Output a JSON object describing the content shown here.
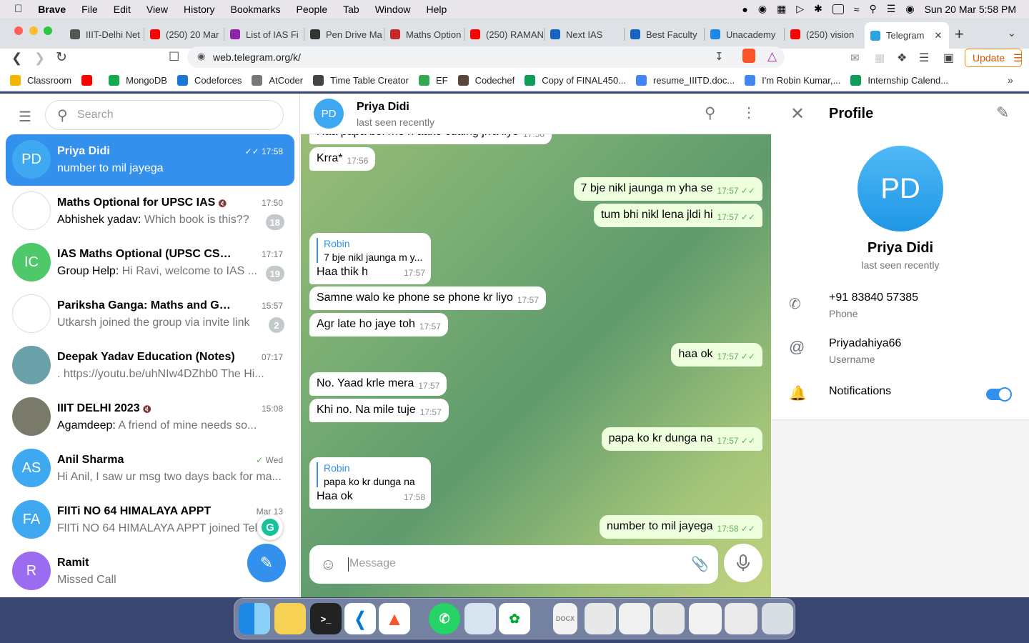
{
  "menubar": {
    "app": "Brave",
    "items": [
      "File",
      "Edit",
      "View",
      "History",
      "Bookmarks",
      "People",
      "Tab",
      "Window",
      "Help"
    ],
    "clock": "Sun 20 Mar  5:58 PM"
  },
  "tabs": [
    {
      "title": "IIIT-Delhi Net",
      "color": "#555"
    },
    {
      "title": "(250) 20 Mar",
      "color": "#ff0000"
    },
    {
      "title": "List of IAS Fi",
      "color": "#8e24aa"
    },
    {
      "title": "Pen Drive Ma",
      "color": "#333"
    },
    {
      "title": "Maths Option",
      "color": "#c62828"
    },
    {
      "title": "(250) RAMAN",
      "color": "#ff0000"
    },
    {
      "title": "Next IAS",
      "color": "#1565c0"
    },
    {
      "title": "Best Faculty",
      "color": "#1565c0"
    },
    {
      "title": "Unacademy",
      "color": "#1e88e5"
    },
    {
      "title": "(250) vision",
      "color": "#ff0000"
    },
    {
      "title": "Telegram",
      "color": "#2aa3e0"
    }
  ],
  "url": "web.telegram.org/k/",
  "update_label": "Update",
  "bookmarks": [
    {
      "label": "Classroom",
      "color": "#f4b400"
    },
    {
      "label": "",
      "color": "#ff0000"
    },
    {
      "label": "MongoDB",
      "color": "#13aa52"
    },
    {
      "label": "Codeforces",
      "color": "#1976d2"
    },
    {
      "label": "AtCoder",
      "color": "#777"
    },
    {
      "label": "Time Table Creator",
      "color": "#444"
    },
    {
      "label": "EF",
      "color": "#34a853"
    },
    {
      "label": "Codechef",
      "color": "#5b4638"
    },
    {
      "label": "Copy of FINAL450...",
      "color": "#0f9d58"
    },
    {
      "label": "resume_IIITD.doc...",
      "color": "#4285f4"
    },
    {
      "label": "I'm Robin Kumar,...",
      "color": "#4285f4"
    },
    {
      "label": "Internship Calend...",
      "color": "#0f9d58"
    }
  ],
  "search": {
    "placeholder": "Search"
  },
  "chats": [
    {
      "initials": "PD",
      "name": "Priya Didi",
      "sender": "",
      "message": "number to mil jayega",
      "time": "17:58",
      "badge": "",
      "color": "#3ea8f0",
      "active": true,
      "read": true,
      "muted": false
    },
    {
      "initials": "",
      "name": "Maths Optional for UPSC IAS",
      "sender": "Abhishek yadav: ",
      "message": "Which book is this??",
      "time": "17:50",
      "badge": "18",
      "color": "#ffffff",
      "active": false,
      "read": false,
      "muted": true
    },
    {
      "initials": "IC",
      "name": "IAS Maths Optional (UPSC CSE)",
      "sender": "Group Help: ",
      "message": "Hi Ravi, welcome to IAS ...",
      "time": "17:17",
      "badge": "19",
      "color": "#4fc86a",
      "active": false,
      "read": false,
      "muted": true
    },
    {
      "initials": "",
      "name": "Pariksha Ganga: Maths and GS(U...",
      "sender": "",
      "message": "Utkarsh joined the group via invite link",
      "time": "15:57",
      "badge": "2",
      "color": "#ffffff",
      "active": false,
      "read": false,
      "muted": true
    },
    {
      "initials": "",
      "name": "Deepak Yadav Education (Notes)",
      "sender": "",
      "message": ". https://youtu.be/uhNIw4DZhb0 The Hi...",
      "time": "07:17",
      "badge": "",
      "color": "#6aa0a8",
      "active": false,
      "read": false,
      "muted": false
    },
    {
      "initials": "",
      "name": "IIIT DELHI 2023",
      "sender": "Agamdeep: ",
      "message": "A friend of mine needs so...",
      "time": "15:08",
      "badge": "",
      "color": "#7a7a6a",
      "active": false,
      "read": false,
      "muted": true
    },
    {
      "initials": "AS",
      "name": "Anil Sharma",
      "sender": "",
      "message": "Hi Anil, I saw ur msg two days back for ma...",
      "time": "Wed",
      "badge": "",
      "color": "#3ea8f0",
      "active": false,
      "read": true,
      "muted": false
    },
    {
      "initials": "FA",
      "name": "FlITi NO 64 HIMALAYA APPT",
      "sender": "",
      "message": "FlITi NO 64 HIMALAYA APPT joined Tel",
      "time": "Mar 13",
      "badge": "",
      "color": "#3ea8f0",
      "active": false,
      "read": false,
      "muted": false
    },
    {
      "initials": "R",
      "name": "Ramit",
      "sender": "",
      "message": "Missed Call",
      "time": "",
      "badge": "",
      "color": "#9b6cf0",
      "active": false,
      "read": false,
      "muted": false
    }
  ],
  "conversation": {
    "initials": "PD",
    "name": "Priya Didi",
    "status": "last seen recently",
    "messages": [
      {
        "dir": "in",
        "text": "Haa papa bol rhe h aake cutting jrra liyo",
        "time": "17:56",
        "reply_name": "",
        "reply_text": ""
      },
      {
        "dir": "in",
        "text": "Krra*",
        "time": "17:56",
        "reply_name": "",
        "reply_text": ""
      },
      {
        "dir": "out",
        "text": "7 bje nikl jaunga m yha se",
        "time": "17:57",
        "reply_name": "",
        "reply_text": ""
      },
      {
        "dir": "out",
        "text": "tum bhi nikl lena jldi hi",
        "time": "17:57",
        "reply_name": "",
        "reply_text": ""
      },
      {
        "dir": "in",
        "text": "Haa thik h",
        "time": "17:57",
        "reply_name": "Robin",
        "reply_text": "7 bje nikl jaunga m y..."
      },
      {
        "dir": "in",
        "text": "Samne walo ke phone se phone kr liyo",
        "time": "17:57",
        "reply_name": "",
        "reply_text": ""
      },
      {
        "dir": "in",
        "text": "Agr late ho jaye toh",
        "time": "17:57",
        "reply_name": "",
        "reply_text": ""
      },
      {
        "dir": "out",
        "text": "haa ok",
        "time": "17:57",
        "reply_name": "",
        "reply_text": ""
      },
      {
        "dir": "in",
        "text": "No. Yaad krle mera",
        "time": "17:57",
        "reply_name": "",
        "reply_text": ""
      },
      {
        "dir": "in",
        "text": "Khi no. Na mile tuje",
        "time": "17:57",
        "reply_name": "",
        "reply_text": ""
      },
      {
        "dir": "out",
        "text": "papa ko kr dunga na",
        "time": "17:57",
        "reply_name": "",
        "reply_text": ""
      },
      {
        "dir": "in",
        "text": "Haa ok",
        "time": "17:58",
        "reply_name": "Robin",
        "reply_text": "papa ko kr dunga na"
      },
      {
        "dir": "out",
        "text": "number to mil jayega",
        "time": "17:58",
        "reply_name": "",
        "reply_text": ""
      }
    ],
    "composer_placeholder": "Message"
  },
  "profile": {
    "title": "Profile",
    "initials": "PD",
    "name": "Priya Didi",
    "status": "last seen recently",
    "phone": "+91 83840 57385",
    "phone_label": "Phone",
    "username": "Priyadahiya66",
    "username_label": "Username",
    "notifications_label": "Notifications",
    "notifications_on": true
  },
  "colors": {
    "accent": "#3390ec",
    "out_bubble": "#eeffde",
    "read_tick": "#5fae5a"
  }
}
